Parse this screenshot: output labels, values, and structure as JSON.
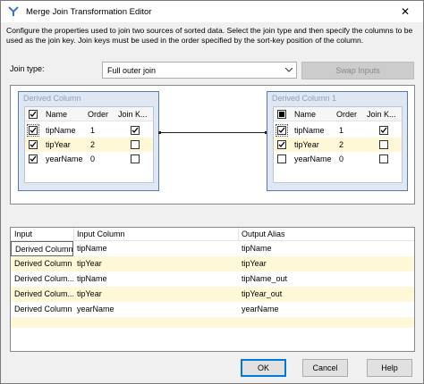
{
  "window": {
    "title": "Merge Join Transformation Editor",
    "close_glyph": "✕",
    "app_icon": "merge-join-icon"
  },
  "description": "Configure the properties used to join two sources of sorted data. Select the join type and then specify the columns to be used as the join key. Join keys must be used in the order specified by the sort-key position of the column.",
  "join_type": {
    "label": "Join type:",
    "value": "Full outer join",
    "swap_label": "Swap Inputs"
  },
  "left_source": {
    "title": "Derived Column",
    "headers": [
      "Name",
      "Order",
      "Join K..."
    ],
    "rows": [
      {
        "name": "tipName",
        "order": "1",
        "selected": true,
        "join_key": true
      },
      {
        "name": "tipYear",
        "order": "2",
        "selected": true,
        "join_key": false
      },
      {
        "name": "yearName",
        "order": "0",
        "selected": true,
        "join_key": false
      }
    ]
  },
  "right_source": {
    "title": "Derived Column 1",
    "headers": [
      "Name",
      "Order",
      "Join K..."
    ],
    "rows": [
      {
        "name": "tipName",
        "order": "1",
        "selected": true,
        "join_key": true
      },
      {
        "name": "tipYear",
        "order": "2",
        "selected": true,
        "join_key": false
      },
      {
        "name": "yearName",
        "order": "0",
        "selected": false,
        "join_key": false
      }
    ]
  },
  "mapping_table": {
    "headers": [
      "Input",
      "Input Column",
      "Output Alias"
    ],
    "rows": [
      [
        "Derived Column",
        "tipName",
        "tipName"
      ],
      [
        "Derived Column",
        "tipYear",
        "tipYear"
      ],
      [
        "Derived Colum...",
        "tipName",
        "tipName_out"
      ],
      [
        "Derived Colum...",
        "tipYear",
        "tipYear_out"
      ],
      [
        "Derived Column",
        "yearName",
        "yearName"
      ]
    ]
  },
  "buttons": {
    "ok": "OK",
    "cancel": "Cancel",
    "help": "Help"
  },
  "colors": {
    "highlight_row": "#fff8d8",
    "source_border": "#5a7aa3",
    "source_bg": "#dfe7f2",
    "default_button_border": "#0078d7"
  }
}
